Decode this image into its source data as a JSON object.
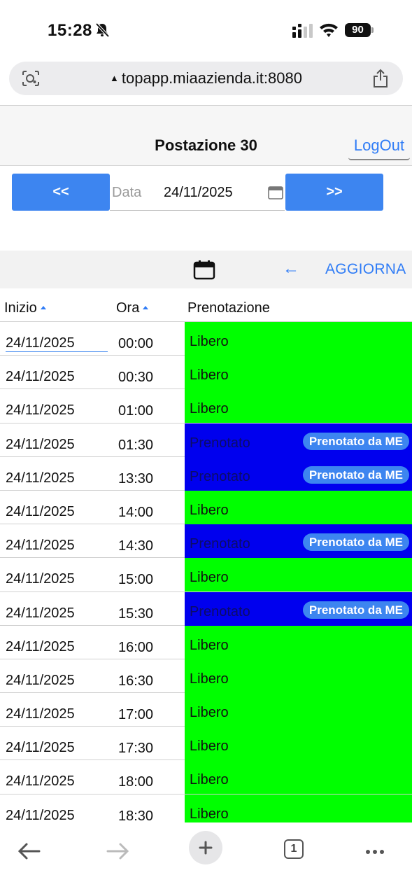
{
  "status_bar": {
    "time": "15:28",
    "battery": "90",
    "icons": [
      "bell-slash-icon",
      "cellular-signal-icon",
      "wifi-icon",
      "battery-icon"
    ]
  },
  "browser": {
    "url": "topapp.miaazienda.it:8080",
    "tab_count": "1",
    "icons": [
      "lens-icon",
      "lock-icon",
      "share-icon",
      "back-arrow-icon",
      "forward-arrow-icon",
      "plus-icon",
      "tabs-icon",
      "more-icon"
    ]
  },
  "header": {
    "title": "Postazione 30",
    "logout_label": "LogOut"
  },
  "date_nav": {
    "prev_label": "<<",
    "next_label": ">>",
    "date_label": "Data",
    "date_value": "24/11/2025"
  },
  "toolbar": {
    "back_label": "←",
    "refresh_label": "AGGIORNA"
  },
  "table": {
    "columns": [
      "Inizio",
      "Ora",
      "Prenotazione"
    ],
    "badge_label": "Prenotato da ME",
    "rows": [
      {
        "date": "24/11/2025",
        "time": "00:00",
        "status": "Libero",
        "booked": false
      },
      {
        "date": "24/11/2025",
        "time": "00:30",
        "status": "Libero",
        "booked": false
      },
      {
        "date": "24/11/2025",
        "time": "01:00",
        "status": "Libero",
        "booked": false
      },
      {
        "date": "24/11/2025",
        "time": "01:30",
        "status": "Prenotato",
        "booked": true
      },
      {
        "date": "24/11/2025",
        "time": "13:30",
        "status": "Prenotato",
        "booked": true
      },
      {
        "date": "24/11/2025",
        "time": "14:00",
        "status": "Libero",
        "booked": false
      },
      {
        "date": "24/11/2025",
        "time": "14:30",
        "status": "Prenotato",
        "booked": true
      },
      {
        "date": "24/11/2025",
        "time": "15:00",
        "status": "Libero",
        "booked": false
      },
      {
        "date": "24/11/2025",
        "time": "15:30",
        "status": "Prenotato",
        "booked": true
      },
      {
        "date": "24/11/2025",
        "time": "16:00",
        "status": "Libero",
        "booked": false
      },
      {
        "date": "24/11/2025",
        "time": "16:30",
        "status": "Libero",
        "booked": false
      },
      {
        "date": "24/11/2025",
        "time": "17:00",
        "status": "Libero",
        "booked": false
      },
      {
        "date": "24/11/2025",
        "time": "17:30",
        "status": "Libero",
        "booked": false
      },
      {
        "date": "24/11/2025",
        "time": "18:00",
        "status": "Libero",
        "booked": false
      },
      {
        "date": "24/11/2025",
        "time": "18:30",
        "status": "Libero",
        "booked": false
      }
    ]
  },
  "colors": {
    "free": "#00ff00",
    "booked": "#0000ee",
    "accent": "#3d85f0",
    "link": "#2f7cf6"
  }
}
